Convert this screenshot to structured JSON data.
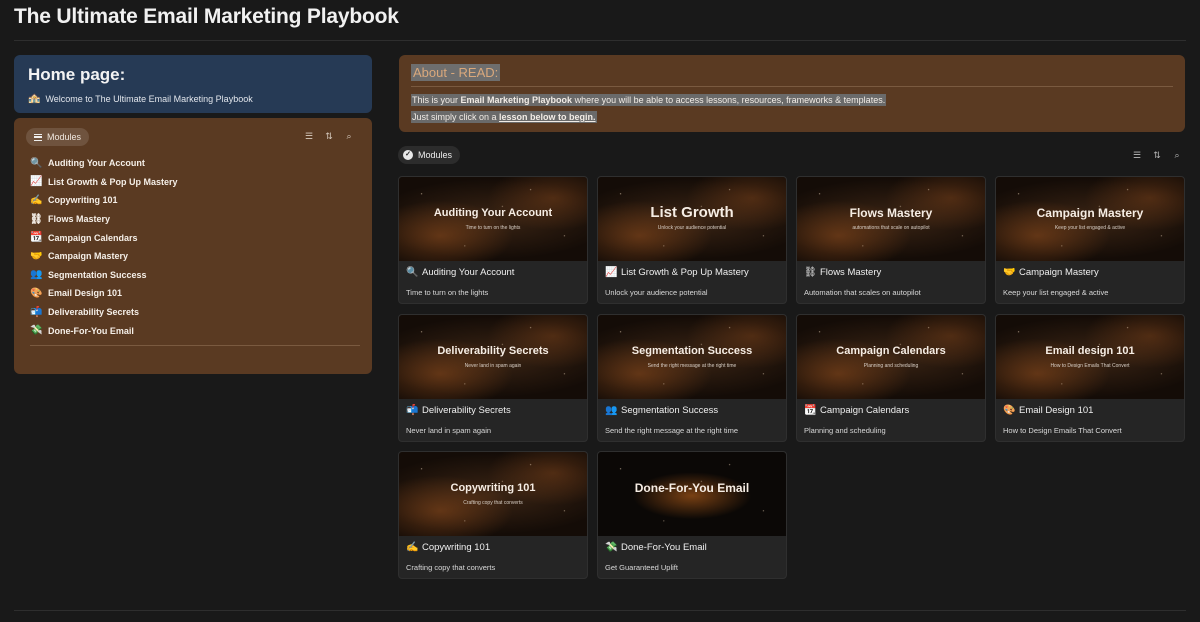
{
  "page": {
    "title": "The Ultimate Email Marketing Playbook"
  },
  "home": {
    "title": "Home page:",
    "welcome_icon": "🏤",
    "welcome_text": "Welcome to The Ultimate Email Marketing Playbook"
  },
  "sidebar": {
    "chip_label": "Modules",
    "items": [
      {
        "icon": "🔍",
        "label": "Auditing Your Account"
      },
      {
        "icon": "📈",
        "label": "List Growth & Pop Up Mastery"
      },
      {
        "icon": "✍️",
        "label": "Copywriting 101"
      },
      {
        "icon": "⛓",
        "label": "Flows Mastery"
      },
      {
        "icon": "📆",
        "label": "Campaign Calendars"
      },
      {
        "icon": "🤝",
        "label": "Campaign Mastery"
      },
      {
        "icon": "👥",
        "label": "Segmentation Success"
      },
      {
        "icon": "🎨",
        "label": "Email Design 101"
      },
      {
        "icon": "📬",
        "label": "Deliverability Secrets"
      },
      {
        "icon": "💸",
        "label": "Done-For-You Email"
      }
    ]
  },
  "about": {
    "title": "About - READ:",
    "line1_a": "This is your ",
    "line1_b": "Email Marketing Playbook",
    "line1_c": " where you will be able to access lessons, resources, frameworks & templates.",
    "line2_a": "Just simply click on a ",
    "line2_b": "lesson below to begin."
  },
  "gallery": {
    "chip_label": "Modules",
    "cards": [
      {
        "thumb_title": "Auditing Your Account",
        "thumb_sub": "Time to turn on the lights",
        "icon": "🔍",
        "name": "Auditing Your Account",
        "desc": "Time to turn on the lights"
      },
      {
        "thumb_title": "List Growth",
        "thumb_sub": "Unlock your audience potential",
        "icon": "📈",
        "name": "List Growth & Pop Up Mastery",
        "desc": "Unlock your audience potential"
      },
      {
        "thumb_title": "Flows Mastery",
        "thumb_sub": "automations that scale on autopilot",
        "icon": "⛓",
        "name": "Flows Mastery",
        "desc": "Automation that scales on autopilot"
      },
      {
        "thumb_title": "Campaign Mastery",
        "thumb_sub": "Keep your list engaged & active",
        "icon": "🤝",
        "name": "Campaign Mastery",
        "desc": "Keep your list engaged & active"
      },
      {
        "thumb_title": "Deliverability Secrets",
        "thumb_sub": "Never land in spam again",
        "icon": "📬",
        "name": "Deliverability Secrets",
        "desc": "Never land in spam again"
      },
      {
        "thumb_title": "Segmentation Success",
        "thumb_sub": "Send the right message at the right time",
        "icon": "👥",
        "name": "Segmentation Success",
        "desc": "Send the right message at the right time"
      },
      {
        "thumb_title": "Campaign Calendars",
        "thumb_sub": "Planning and scheduling",
        "icon": "📆",
        "name": "Campaign Calendars",
        "desc": "Planning and scheduling"
      },
      {
        "thumb_title": "Email design 101",
        "thumb_sub": "How to Design Emails That Convert",
        "icon": "🎨",
        "name": "Email Design 101",
        "desc": "How to Design Emails That Convert"
      },
      {
        "thumb_title": "Copywriting 101",
        "thumb_sub": "Crafting copy that converts",
        "icon": "✍️",
        "name": "Copywriting 101",
        "desc": "Crafting copy that converts"
      },
      {
        "thumb_title": "Done-For-You Email",
        "thumb_sub": "",
        "icon": "💸",
        "name": "Done-For-You Email",
        "desc": "Get Guaranteed Uplift"
      }
    ]
  }
}
